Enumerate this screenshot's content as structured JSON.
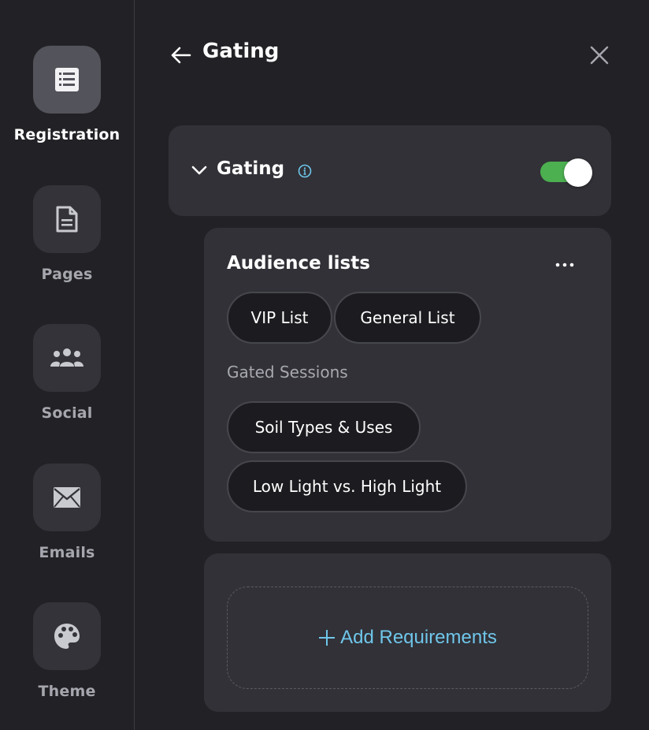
{
  "sidebar": {
    "items": [
      {
        "label": "Registration",
        "icon": "list-form-icon",
        "active": true
      },
      {
        "label": "Pages",
        "icon": "document-icon",
        "active": false
      },
      {
        "label": "Social",
        "icon": "people-icon",
        "active": false
      },
      {
        "label": "Emails",
        "icon": "envelope-icon",
        "active": false
      },
      {
        "label": "Theme",
        "icon": "palette-icon",
        "active": false
      }
    ]
  },
  "header": {
    "title": "Gating"
  },
  "gating": {
    "label": "Gating",
    "toggle_on": true
  },
  "audience": {
    "title": "Audience lists",
    "lists": [
      "VIP List",
      "General List"
    ],
    "sessions_label": "Gated Sessions",
    "sessions": [
      "Soil Types & Uses",
      "Low Light vs. High Light"
    ]
  },
  "requirements": {
    "add_label": "Add Requirements"
  },
  "colors": {
    "background": "#222226",
    "card": "#313137",
    "accent": "#6fc6ea",
    "toggle_on": "#4caf50"
  }
}
